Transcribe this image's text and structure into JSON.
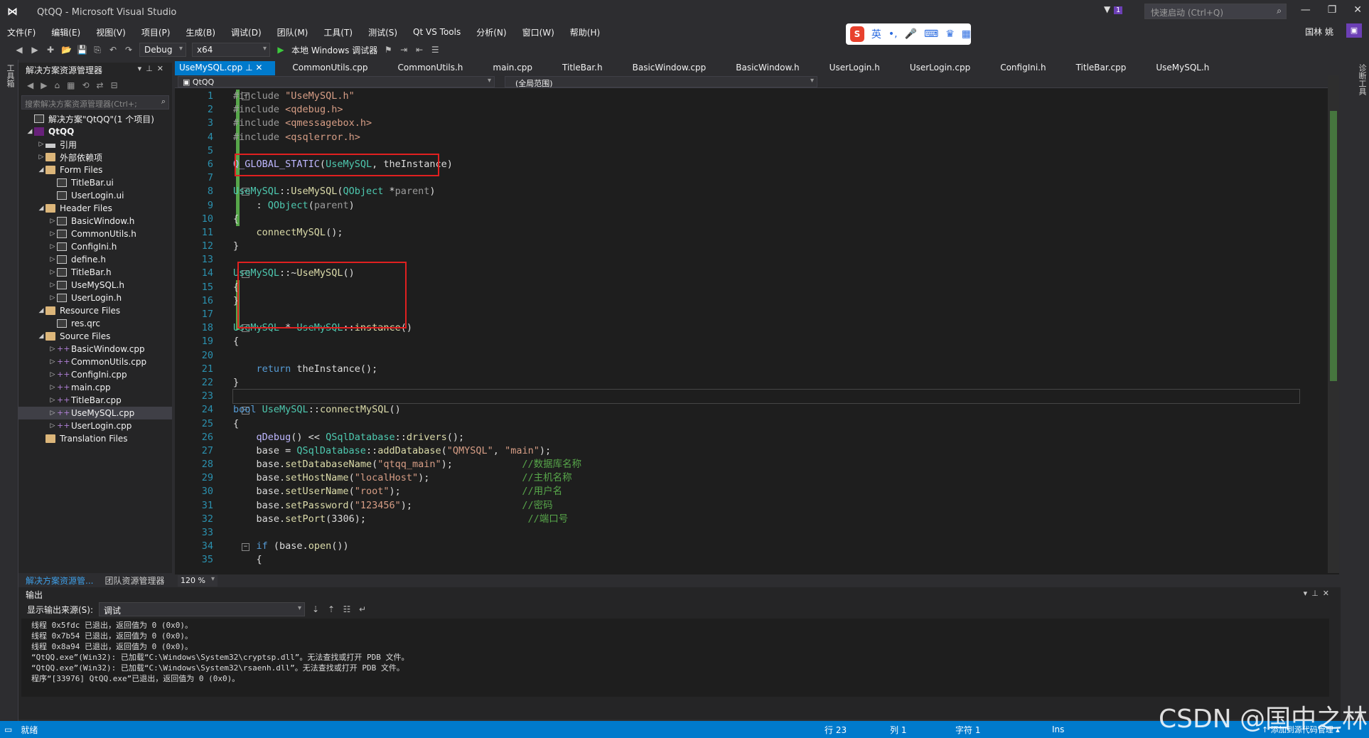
{
  "window": {
    "title": "QtQQ - Microsoft Visual Studio",
    "quick_launch": "快速启动 (Ctrl+Q)",
    "notify_count": "1",
    "user": "国林 姚"
  },
  "menu": [
    "文件(F)",
    "编辑(E)",
    "视图(V)",
    "项目(P)",
    "生成(B)",
    "调试(D)",
    "团队(M)",
    "工具(T)",
    "测试(S)",
    "Qt VS Tools",
    "分析(N)",
    "窗口(W)",
    "帮助(H)"
  ],
  "toolbar": {
    "config": "Debug",
    "platform": "x64",
    "run_label": "本地 Windows 调试器"
  },
  "ime": {
    "mode": "英"
  },
  "left_strip": "工具箱",
  "right_strip": "诊断工具",
  "solution": {
    "title": "解决方案资源管理器",
    "search_placeholder": "搜索解决方案资源管理器(Ctrl+;",
    "tree": [
      {
        "label": "解决方案\"QtQQ\"(1 个项目)",
        "level": 0,
        "type": "solution",
        "arrow": ""
      },
      {
        "label": "QtQQ",
        "level": 0,
        "type": "project",
        "arrow": "◢",
        "bold": true
      },
      {
        "label": "引用",
        "level": 1,
        "type": "ref",
        "arrow": "▷"
      },
      {
        "label": "外部依赖项",
        "level": 1,
        "type": "folder",
        "arrow": "▷"
      },
      {
        "label": "Form Files",
        "level": 1,
        "type": "folder",
        "arrow": "◢"
      },
      {
        "label": "TitleBar.ui",
        "level": 2,
        "type": "file",
        "arrow": ""
      },
      {
        "label": "UserLogin.ui",
        "level": 2,
        "type": "file",
        "arrow": ""
      },
      {
        "label": "Header Files",
        "level": 1,
        "type": "folder",
        "arrow": "◢"
      },
      {
        "label": "BasicWindow.h",
        "level": 2,
        "type": "file",
        "arrow": "▷"
      },
      {
        "label": "CommonUtils.h",
        "level": 2,
        "type": "file",
        "arrow": "▷"
      },
      {
        "label": "ConfigIni.h",
        "level": 2,
        "type": "file",
        "arrow": "▷"
      },
      {
        "label": "define.h",
        "level": 2,
        "type": "file",
        "arrow": "▷"
      },
      {
        "label": "TitleBar.h",
        "level": 2,
        "type": "file",
        "arrow": "▷"
      },
      {
        "label": "UseMySQL.h",
        "level": 2,
        "type": "file",
        "arrow": "▷"
      },
      {
        "label": "UserLogin.h",
        "level": 2,
        "type": "file",
        "arrow": "▷"
      },
      {
        "label": "Resource Files",
        "level": 1,
        "type": "folder",
        "arrow": "◢"
      },
      {
        "label": "res.qrc",
        "level": 2,
        "type": "file",
        "arrow": ""
      },
      {
        "label": "Source Files",
        "level": 1,
        "type": "folder",
        "arrow": "◢"
      },
      {
        "label": "BasicWindow.cpp",
        "level": 2,
        "type": "cpp",
        "arrow": "▷"
      },
      {
        "label": "CommonUtils.cpp",
        "level": 2,
        "type": "cpp",
        "arrow": "▷"
      },
      {
        "label": "ConfigIni.cpp",
        "level": 2,
        "type": "cpp",
        "arrow": "▷"
      },
      {
        "label": "main.cpp",
        "level": 2,
        "type": "cpp",
        "arrow": "▷"
      },
      {
        "label": "TitleBar.cpp",
        "level": 2,
        "type": "cpp",
        "arrow": "▷"
      },
      {
        "label": "UseMySQL.cpp",
        "level": 2,
        "type": "cpp",
        "arrow": "▷",
        "selected": true
      },
      {
        "label": "UserLogin.cpp",
        "level": 2,
        "type": "cpp",
        "arrow": "▷"
      },
      {
        "label": "Translation Files",
        "level": 1,
        "type": "folder",
        "arrow": ""
      }
    ],
    "bottom_tabs": [
      "解决方案资源管...",
      "团队资源管理器"
    ]
  },
  "editor": {
    "tabs": [
      "UseMySQL.cpp",
      "CommonUtils.cpp",
      "CommonUtils.h",
      "main.cpp",
      "TitleBar.h",
      "BasicWindow.cpp",
      "BasicWindow.h",
      "UserLogin.h",
      "UserLogin.cpp",
      "ConfigIni.h",
      "TitleBar.cpp",
      "UseMySQL.h"
    ],
    "project_nav": "QtQQ",
    "scope_nav": "(全局范围)",
    "zoom": "120 %",
    "lines": [
      "<span class=\"pp\">#include</span> <span class=\"s\">\"UseMySQL.h\"</span>",
      "<span class=\"pp\">#include</span> <span class=\"s\">&lt;qdebug.h&gt;</span>",
      "<span class=\"pp\">#include</span> <span class=\"s\">&lt;qmessagebox.h&gt;</span>",
      "<span class=\"pp\">#include</span> <span class=\"s\">&lt;qsqlerror.h&gt;</span>",
      "",
      "<span class=\"m\">Q_GLOBAL_STATIC</span>(<span class=\"t\">UseMySQL</span>, theInstance)",
      "",
      "<span class=\"t\">UseMySQL</span>::<span class=\"f\">UseMySQL</span>(<span class=\"t\">QObject</span> *<span class=\"p\">parent</span>)",
      "    : <span class=\"t\">QObject</span>(<span class=\"p\">parent</span>)",
      "{",
      "    <span class=\"f\">connectMySQL</span>();",
      "}",
      "",
      "<span class=\"t\">UseMySQL</span>::~<span class=\"f\">UseMySQL</span>()",
      "{",
      "}",
      "",
      "<span class=\"t\">UseMySQL</span> * <span class=\"t\">UseMySQL</span>::<span class=\"f\">instance</span>()",
      "{",
      "",
      "    <span class=\"k\">return</span> theInstance();",
      "}",
      "",
      "<span class=\"k\">bool</span> <span class=\"t\">UseMySQL</span>::<span class=\"f\">connectMySQL</span>()",
      "{",
      "    <span class=\"m\">qDebug</span>() &lt;&lt; <span class=\"t\">QSqlDatabase</span>::<span class=\"f\">drivers</span>();",
      "    base = <span class=\"t\">QSqlDatabase</span>::<span class=\"f\">addDatabase</span>(<span class=\"s\">\"QMYSQL\"</span>, <span class=\"s\">\"main\"</span>);",
      "    base.<span class=\"f\">setDatabaseName</span>(<span class=\"s\">\"qtqq_main\"</span>);            <span class=\"c\">//数据库名称</span>",
      "    base.<span class=\"f\">setHostName</span>(<span class=\"s\">\"localHost\"</span>);                <span class=\"c\">//主机名称</span>",
      "    base.<span class=\"f\">setUserName</span>(<span class=\"s\">\"root\"</span>);                     <span class=\"c\">//用户名</span>",
      "    base.<span class=\"f\">setPassword</span>(<span class=\"s\">\"123456\"</span>);                   <span class=\"c\">//密码</span>",
      "    base.<span class=\"f\">setPort</span>(3306);                            <span class=\"c\">//端口号</span>",
      "",
      "    <span class=\"k\">if</span> (base.<span class=\"f\">open</span>())",
      "    {"
    ]
  },
  "output": {
    "title": "输出",
    "source_label": "显示输出来源(S):",
    "source_value": "调试",
    "lines": [
      "线程 0x5fdc 已退出，返回值为 0 (0x0)。",
      "线程 0x7b54 已退出，返回值为 0 (0x0)。",
      "线程 0x8a94 已退出，返回值为 0 (0x0)。",
      "“QtQQ.exe”(Win32): 已加载“C:\\Windows\\System32\\cryptsp.dll”。无法查找或打开 PDB 文件。",
      "“QtQQ.exe”(Win32): 已加载“C:\\Windows\\System32\\rsaenh.dll”。无法查找或打开 PDB 文件。",
      "程序“[33976] QtQQ.exe”已退出，返回值为 0 (0x0)。"
    ]
  },
  "status": {
    "state": "就绪",
    "row": "行 23",
    "col": "列 1",
    "char": "字符 1",
    "ins": "Ins",
    "source_control": "↑ 添加到源代码管理 ▴"
  },
  "watermark": "CSDN @国中之林",
  "colors": {
    "accent": "#007acc",
    "highlight_box": "#e02020",
    "change_bar": "#57a64a"
  }
}
